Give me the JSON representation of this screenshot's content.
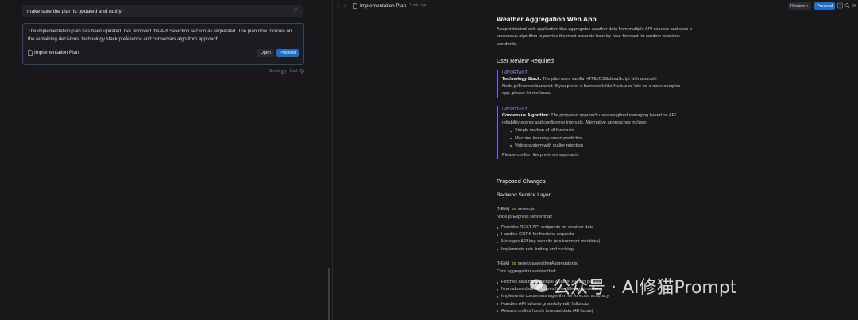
{
  "chat": {
    "user_message": "make sure the plan is updated and notify",
    "assistant_message": "The implementation plan has been updated. I've removed the API Selection section as requested. The plan now focuses on the remaining decisions: technology stack preference and consensus algorithm approach.",
    "artifact_label": "Implementation Plan",
    "open_label": "Open",
    "proceed_label": "Proceed",
    "good_label": "Good",
    "bad_label": "Bad"
  },
  "tab": {
    "title": "Implementation Plan",
    "time": "1 min ago",
    "review_label": "Review",
    "proceed_label": "Proceed"
  },
  "doc": {
    "title": "Weather Aggregation Web App",
    "intro": "A sophisticated web application that aggregates weather data from multiple API sources and uses a consensus algorithm to provide the most accurate hour-by-hour forecast for random locations worldwide.",
    "review_heading": "User Review Required",
    "callout1": {
      "tag": "IMPORTANT",
      "bold": "Technology Stack:",
      "text": " The plan uses vanilla HTML/CSS/JavaScript with a simple Node.js/Express backend. If you prefer a framework like Next.js or Vite for a more complex app, please let me know."
    },
    "callout2": {
      "tag": "IMPORTANT",
      "bold": "Consensus Algorithm:",
      "text": " The proposed approach uses weighted averaging based on API reliability scores and confidence intervals. Alternative approaches include:",
      "items": [
        "Simple median of all forecasts",
        "Machine learning-based prediction",
        "Voting system with outlier rejection"
      ],
      "footer": "Please confirm the preferred approach."
    },
    "changes_heading": "Proposed Changes",
    "backend_heading": "Backend Service Layer",
    "file1": {
      "tag": "[NEW]",
      "icon": "JS",
      "name": "server.js",
      "desc": "Node.js/Express server that:",
      "items": [
        "Provides REST API endpoints for weather data",
        "Handles CORS for frontend requests",
        "Manages API key security (environment variables)",
        "Implements rate limiting and caching"
      ]
    },
    "file2": {
      "tag": "[NEW]",
      "icon": "JS",
      "name": "services/weatherAggregator.js",
      "desc": "Core aggregation service that:",
      "items": [
        "Fetches data from multiple weather APIs in parallel",
        "Normalizes data structures from different providers",
        "Implements consensus algorithm for forecast accuracy",
        "Handles API failures gracefully with fallbacks",
        "Returns unified hourly forecast data (48 hours)"
      ]
    }
  },
  "watermark": {
    "text": "公众号 · AI修猫Prompt"
  },
  "colors": {
    "accent_blue": "#1e6dc8",
    "callout_purple": "#8b5cf6",
    "background": "#18181b"
  }
}
